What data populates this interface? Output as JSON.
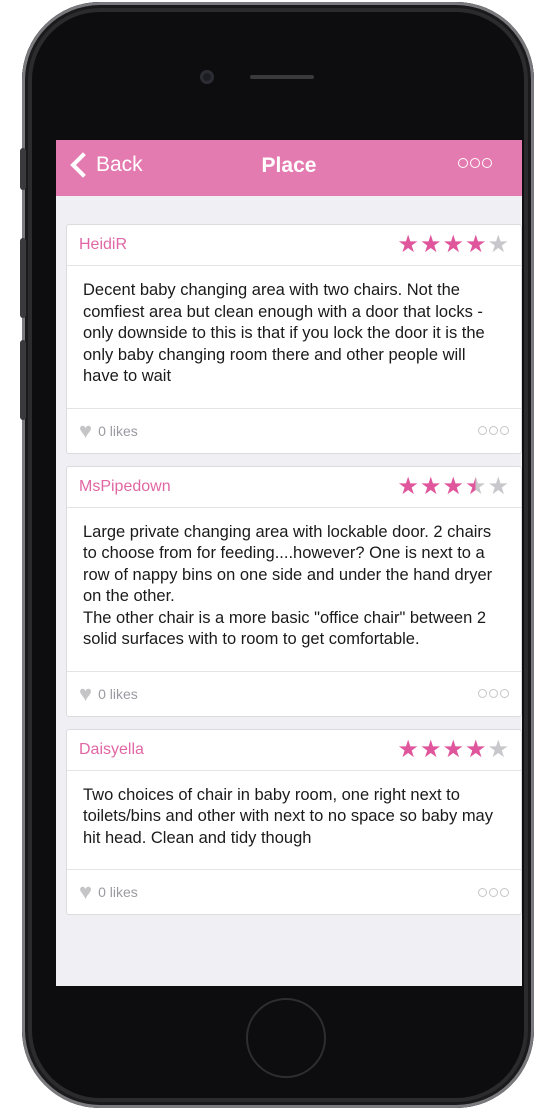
{
  "navbar": {
    "back_label": "Back",
    "title": "Place",
    "accent_color": "#e47bb0"
  },
  "reviews": [
    {
      "author": "HeidiR",
      "rating": 4,
      "text": "Decent baby changing area with two chairs. Not the comfiest area but clean enough with a door that locks - only downside to this is that if you lock the door it is the only baby changing room there and other people will have to wait",
      "likes": "0 likes"
    },
    {
      "author": "MsPipedown",
      "rating": 3.5,
      "text": "Large private changing area with lockable door. 2 chairs to choose from for feeding....however? One is next to a row of nappy bins on one side and under the hand dryer on the other.\nThe other chair is a more basic \"office chair\" between 2 solid surfaces with to room to get comfortable.",
      "likes": "0 likes"
    },
    {
      "author": "Daisyella",
      "rating": 4,
      "text": "Two choices of chair in baby room, one right next to toilets/bins and other with next to no space so baby may hit head. Clean and tidy though",
      "likes": "0 likes"
    }
  ]
}
